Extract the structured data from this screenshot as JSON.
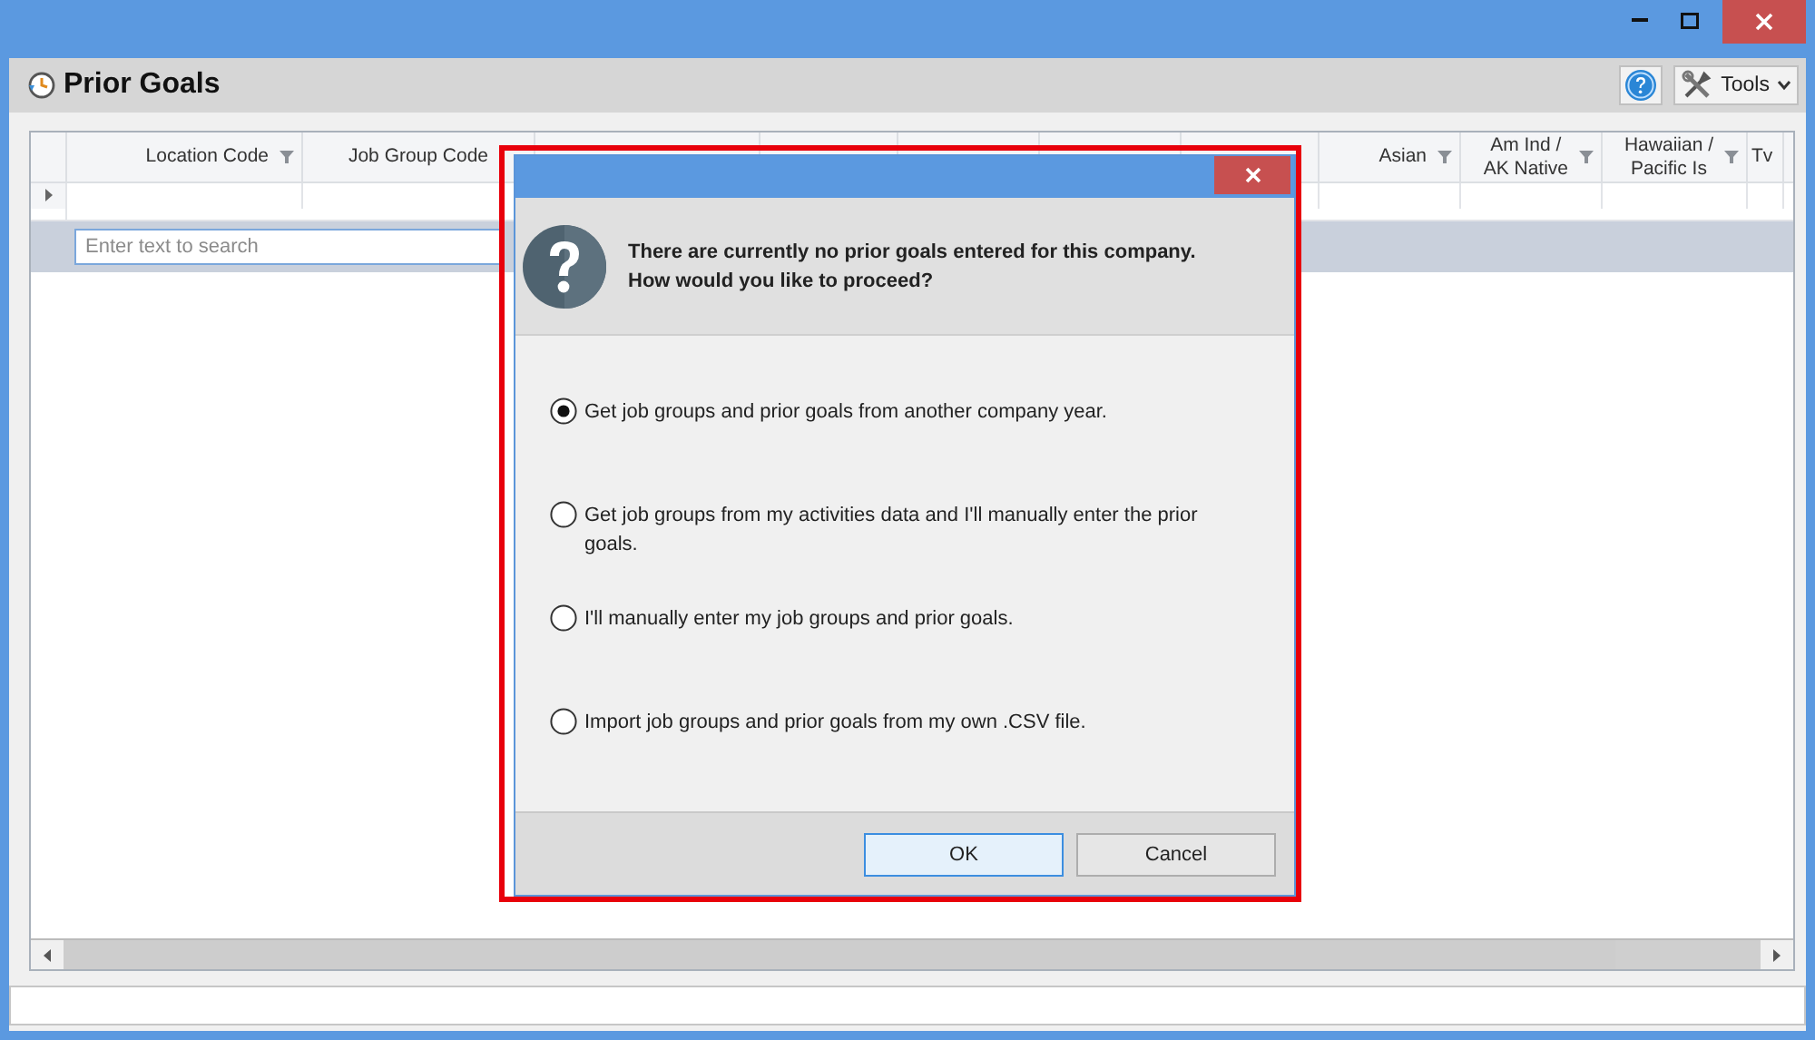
{
  "window": {
    "title": "Prior Goals",
    "toolbar": {
      "tools_label": "Tools"
    }
  },
  "grid": {
    "columns": [
      {
        "label": "Location Code"
      },
      {
        "label": "Job Group Code"
      },
      {
        "label": "Asian"
      },
      {
        "label": "Am Ind /\nAK Native"
      },
      {
        "label": "Hawaiian /\nPacific Is"
      },
      {
        "label": "Tv"
      }
    ],
    "search": {
      "placeholder": "Enter text to search"
    }
  },
  "dialog": {
    "message": "There are currently no prior goals entered for this company.\nHow would you like to proceed?",
    "options": [
      {
        "label": "Get job groups and prior goals from another company year.",
        "selected": true
      },
      {
        "label": "Get job groups from my activities data and I'll manually enter the prior goals.",
        "selected": false
      },
      {
        "label": "I'll manually enter my job groups and prior goals.",
        "selected": false
      },
      {
        "label": "Import job groups and prior goals from my own .CSV file.",
        "selected": false
      }
    ],
    "buttons": [
      {
        "label": "OK",
        "kind": "default"
      },
      {
        "label": "Cancel",
        "kind": "normal"
      }
    ]
  }
}
